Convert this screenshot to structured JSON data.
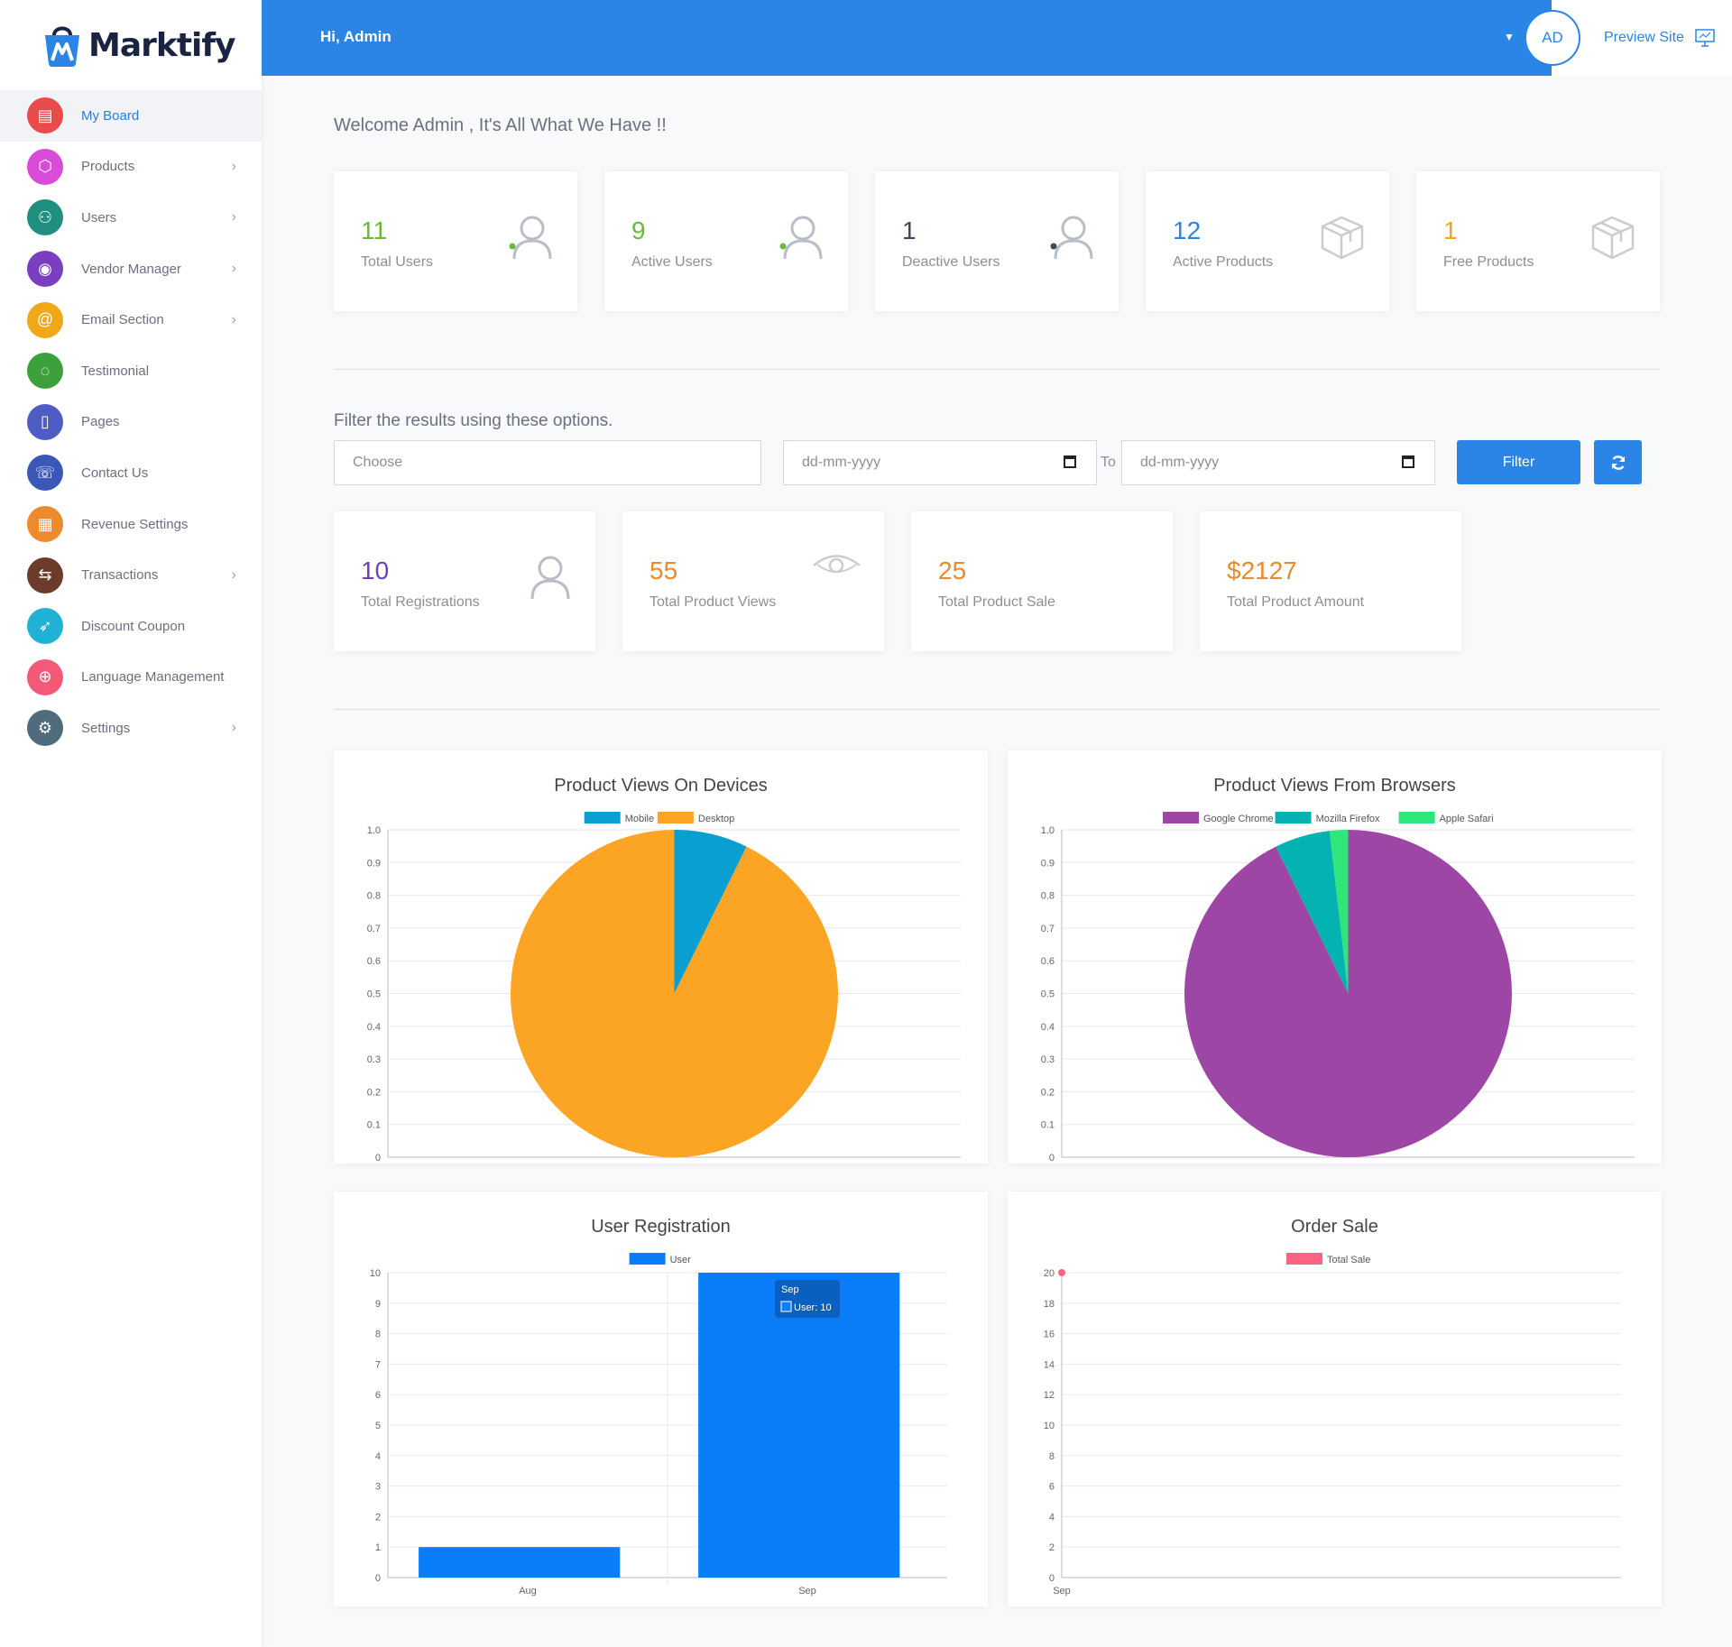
{
  "brand": {
    "name": "Marktify"
  },
  "sidebar": {
    "items": [
      {
        "label": "My Board",
        "icon": "presentation-icon",
        "color": "#e94b4b",
        "active": true,
        "chevron": false
      },
      {
        "label": "Products",
        "icon": "box-icon",
        "color": "#d94bd9",
        "chevron": true
      },
      {
        "label": "Users",
        "icon": "users-icon",
        "color": "#1f8f7f",
        "chevron": true
      },
      {
        "label": "Vendor Manager",
        "icon": "user-circle-icon",
        "color": "#7a3fbf",
        "chevron": true
      },
      {
        "label": "Email Section",
        "icon": "at-icon",
        "color": "#f0a818",
        "chevron": true
      },
      {
        "label": "Testimonial",
        "icon": "chat-icon",
        "color": "#3ca03c",
        "chevron": false
      },
      {
        "label": "Pages",
        "icon": "page-icon",
        "color": "#4e5cc4",
        "chevron": false
      },
      {
        "label": "Contact Us",
        "icon": "phone-icon",
        "color": "#3b58b8",
        "chevron": false
      },
      {
        "label": "Revenue Settings",
        "icon": "clipboard-icon",
        "color": "#ec8a2c",
        "chevron": false
      },
      {
        "label": "Transactions",
        "icon": "exchange-icon",
        "color": "#6b3b2b",
        "chevron": true
      },
      {
        "label": "Discount Coupon",
        "icon": "rocket-icon",
        "color": "#1fb2d6",
        "chevron": false
      },
      {
        "label": "Language Management",
        "icon": "globe-icon",
        "color": "#f25a78",
        "chevron": false
      },
      {
        "label": "Settings",
        "icon": "gear-icon",
        "color": "#4f6b7c",
        "chevron": true
      }
    ]
  },
  "header": {
    "greeting": "Hi, Admin",
    "avatar": "AD",
    "preview": "Preview Site"
  },
  "welcome": "Welcome Admin , It's All What We Have !!",
  "stats": [
    {
      "value": "11",
      "label": "Total Users",
      "color": "#6cb83c",
      "icon": "user-icon",
      "dot": "#6cb83c"
    },
    {
      "value": "9",
      "label": "Active Users",
      "color": "#6cb83c",
      "icon": "user-icon",
      "dot": "#6cb83c"
    },
    {
      "value": "1",
      "label": "Deactive Users",
      "color": "#3b4a5c",
      "icon": "user-icon",
      "dot": "#3b4a5c"
    },
    {
      "value": "12",
      "label": "Active Products",
      "color": "#2a85e6",
      "icon": "box-icon"
    },
    {
      "value": "1",
      "label": "Free Products",
      "color": "#f0a818",
      "icon": "box-icon"
    }
  ],
  "filter": {
    "title": "Filter the results using these options.",
    "choose_placeholder": "Choose",
    "date_placeholder": "dd-mm-yyyy",
    "to": "To",
    "filter_btn": "Filter"
  },
  "stats2": [
    {
      "value": "10",
      "label": "Total Registrations",
      "color": "#6a3fb8",
      "icon": "user-icon"
    },
    {
      "value": "55",
      "label": "Total Product Views",
      "color": "#e98a2c",
      "icon": "eye-icon"
    },
    {
      "value": "25",
      "label": "Total Product Sale",
      "color": "#e98a2c",
      "icon": ""
    },
    {
      "value": "$2127",
      "label": "Total Product Amount",
      "color": "#e98a2c",
      "icon": ""
    }
  ],
  "chart_data": [
    {
      "type": "pie",
      "title": "Product Views On Devices",
      "labels": [
        "Mobile",
        "Desktop"
      ],
      "values": [
        4,
        51
      ],
      "colors": [
        "#0a9fd1",
        "#fca424"
      ],
      "ylim": [
        0,
        1
      ],
      "yticks": [
        "1.0",
        "0.9",
        "0.8",
        "0.7",
        "0.6",
        "0.5",
        "0.4",
        "0.3",
        "0.2",
        "0.1",
        "0"
      ],
      "legend": "top"
    },
    {
      "type": "pie",
      "title": "Product Views From Browsers",
      "labels": [
        "Google Chrome",
        "Mozilla Firefox",
        "Apple Safari"
      ],
      "values": [
        51,
        3,
        1
      ],
      "colors": [
        "#9e46a6",
        "#04b2b2",
        "#2ee67a"
      ],
      "ylim": [
        0,
        1
      ],
      "yticks": [
        "1.0",
        "0.9",
        "0.8",
        "0.7",
        "0.6",
        "0.5",
        "0.4",
        "0.3",
        "0.2",
        "0.1",
        "0"
      ],
      "legend": "top"
    },
    {
      "type": "bar",
      "title": "User Registration",
      "categories": [
        "Aug",
        "Sep"
      ],
      "series": [
        {
          "name": "User",
          "values": [
            1,
            10
          ],
          "color": "#0a7ef8"
        }
      ],
      "ylim": [
        0,
        10
      ],
      "yticks": [
        "10",
        "9",
        "8",
        "7",
        "6",
        "5",
        "4",
        "3",
        "2",
        "1",
        "0"
      ],
      "tooltip": {
        "title": "Sep",
        "text": "User: 10"
      },
      "legend": "top"
    },
    {
      "type": "line",
      "title": "Order Sale",
      "categories": [
        "Sep"
      ],
      "series": [
        {
          "name": "Total Sale",
          "values": [
            20
          ],
          "color": "#ff6384"
        }
      ],
      "ylim": [
        0,
        20
      ],
      "yticks": [
        "20",
        "18",
        "16",
        "14",
        "12",
        "10",
        "8",
        "6",
        "4",
        "2",
        "0"
      ],
      "legend": "top"
    }
  ]
}
